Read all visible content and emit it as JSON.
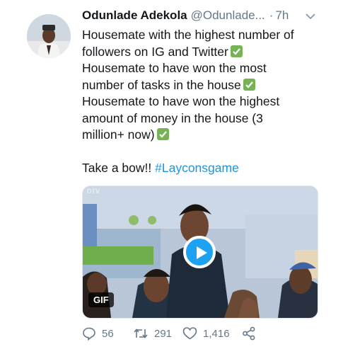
{
  "tweet": {
    "author_name": "Odunlade Adekola",
    "handle": "@Odunlade...",
    "separator": "·",
    "time": "7h",
    "lines": [
      "Housemate with the highest number of",
      "followers on IG and Twitter",
      "Housemate to have won the most",
      "number of tasks in the house",
      "Housemate to have won the highest",
      "amount of money in the house (3",
      "million+ now)"
    ],
    "closing_text": "Take a bow!! ",
    "hashtag": "#Layconsgame",
    "check_emoji": "white-heavy-check-mark-icon"
  },
  "media": {
    "badge": "GIF",
    "watermark": "DTV",
    "play_icon": "play-icon"
  },
  "actions": {
    "reply_count": "56",
    "retweet_count": "291",
    "like_count": "1,416"
  },
  "colors": {
    "link": "#1b95e0",
    "muted": "#657786",
    "check": "#77b255",
    "play": "#1da1f2"
  }
}
